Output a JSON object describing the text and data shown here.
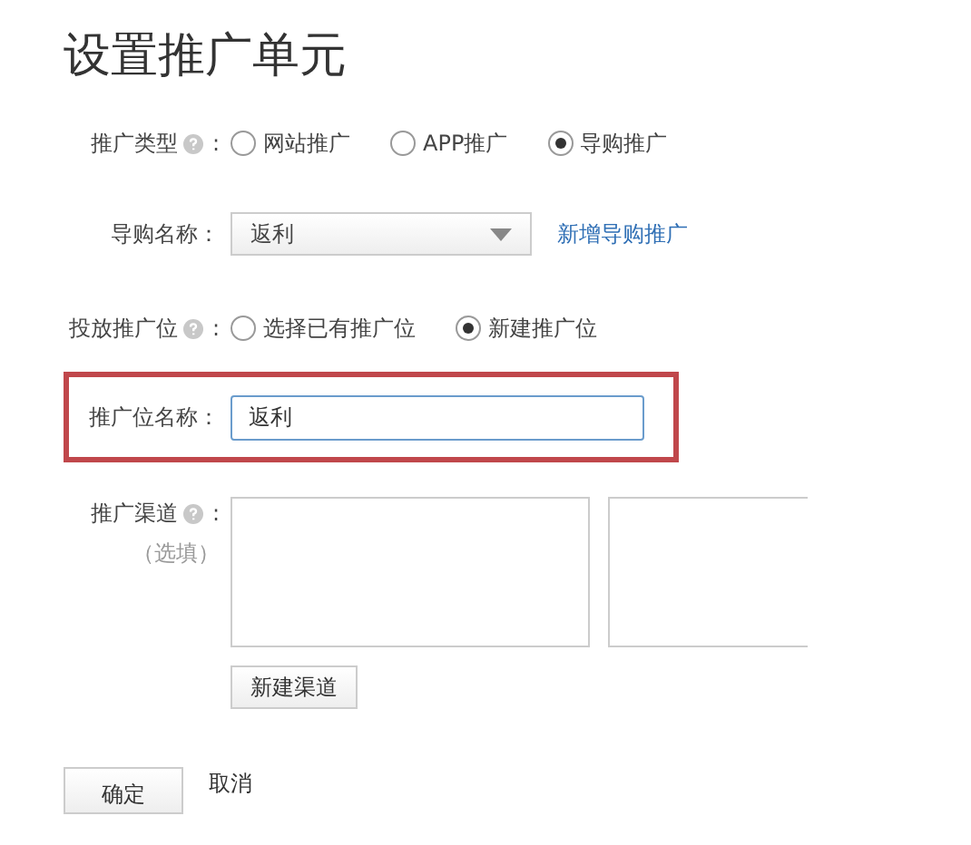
{
  "title": "设置推广单元",
  "promo_type": {
    "label": "推广类型",
    "help": true,
    "colon": ":",
    "options": [
      {
        "label": "网站推广",
        "selected": false
      },
      {
        "label": "APP推广",
        "selected": false
      },
      {
        "label": "导购推广",
        "selected": true
      }
    ]
  },
  "guide_name": {
    "label": "导购名称：",
    "value": "返利",
    "link": "新增导购推广"
  },
  "placement": {
    "label": "投放推广位",
    "help": true,
    "colon": ":",
    "options": [
      {
        "label": "选择已有推广位",
        "selected": false
      },
      {
        "label": "新建推广位",
        "selected": true
      }
    ]
  },
  "placement_name": {
    "label": "推广位名称：",
    "value": "返利",
    "highlighted": true
  },
  "channel": {
    "label": "推广渠道",
    "help": true,
    "colon": ":",
    "note": "（选填）",
    "button": "新建渠道"
  },
  "actions": {
    "confirm": "确定",
    "cancel": "取消"
  }
}
